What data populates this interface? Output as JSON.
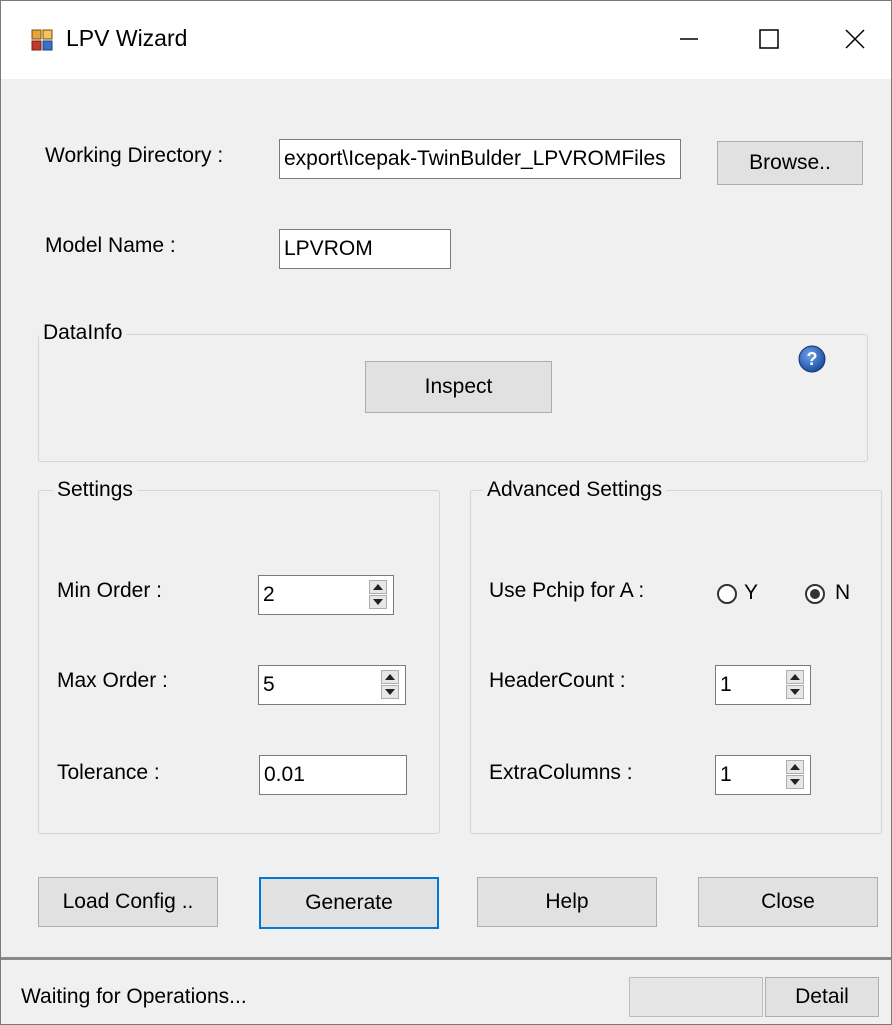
{
  "window": {
    "title": "LPV Wizard",
    "app_icon": "lpv-app-icon",
    "controls": [
      "minimize-icon",
      "maximize-icon",
      "close-icon"
    ]
  },
  "working_directory": {
    "label": "Working Directory :",
    "value": "export\\Icepak-TwinBulder_LPVROMFiles",
    "browse_label": "Browse.."
  },
  "model_name": {
    "label": "Model Name :",
    "value": "LPVROM"
  },
  "datainfo": {
    "legend": "DataInfo",
    "inspect_label": "Inspect",
    "help_icon": "question-mark-icon"
  },
  "settings": {
    "legend": "Settings",
    "min_order": {
      "label": "Min Order :",
      "value": "2"
    },
    "max_order": {
      "label": "Max Order :",
      "value": "5"
    },
    "tolerance": {
      "label": "Tolerance :",
      "value": "0.01"
    }
  },
  "advanced": {
    "legend": "Advanced Settings",
    "use_pchip": {
      "label": "Use Pchip for A :",
      "option_y": "Y",
      "option_n": "N",
      "selected": "N"
    },
    "header_count": {
      "label": "HeaderCount :",
      "value": "1"
    },
    "extra_columns": {
      "label": "ExtraColumns :",
      "value": "1"
    }
  },
  "actions": {
    "load_config": "Load Config ..",
    "generate": "Generate",
    "help": "Help",
    "close": "Close"
  },
  "status": {
    "text": "Waiting for Operations...",
    "detail_label": "Detail",
    "progress": 0
  },
  "colors": {
    "window_bg": "#f0f0f0",
    "accent": "#0078d7",
    "help_icon": "#1c4fa0"
  }
}
